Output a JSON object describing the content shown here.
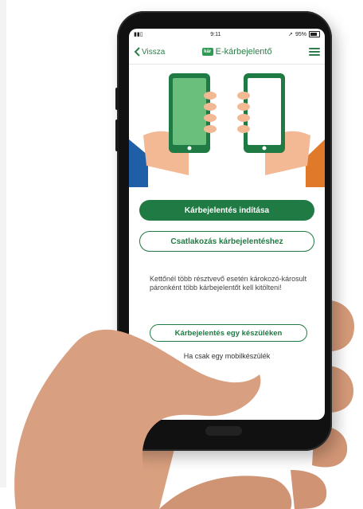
{
  "status": {
    "time": "9:11",
    "battery": "95%"
  },
  "nav": {
    "back_label": "Vissza",
    "logo_text": "kár",
    "title": "E-kárbejelentő"
  },
  "actions": {
    "start_label": "Kárbejelentés indítása",
    "join_label": "Csatlakozás kárbejelentéshez"
  },
  "info": {
    "text": "Kettőnél több résztvevő esetén károkozó-károsult páronként több kárbejelentőt kell kitölteni!"
  },
  "single": {
    "button_label": "Kárbejelentés egy készüléken",
    "footnote": "Ha csak egy mobilkészülék"
  },
  "colors": {
    "brand_green": "#1f7a43",
    "accent_blue": "#1f5fa8",
    "accent_orange": "#e07a2a"
  },
  "icons": [
    "chevron-left-icon",
    "menu-icon",
    "signal-icon",
    "wifi-icon",
    "battery-icon"
  ]
}
